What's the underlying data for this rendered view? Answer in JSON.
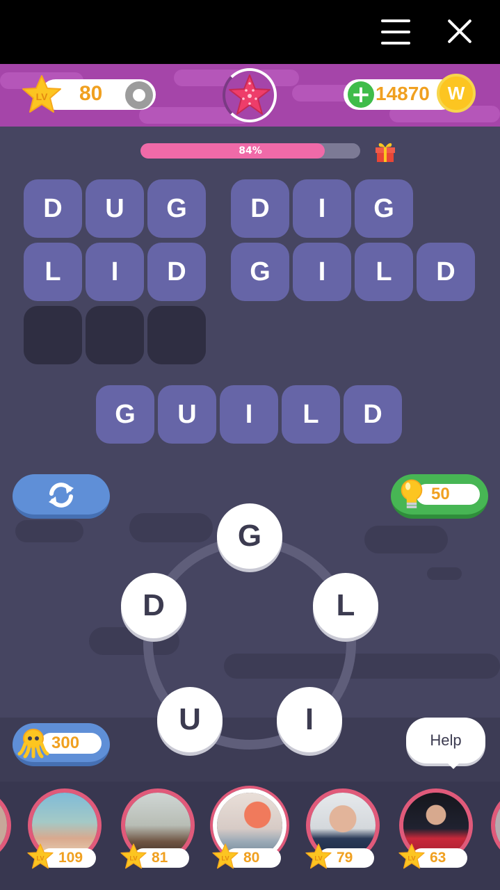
{
  "header": {
    "level": "80",
    "coins": "14870",
    "coin_symbol": "W",
    "star_badge_label": "LV"
  },
  "progress": {
    "label": "84%",
    "value": 0.84
  },
  "puzzle": {
    "words": [
      {
        "letters": [
          "D",
          "U",
          "G"
        ],
        "solved": true
      },
      {
        "letters": [
          "D",
          "I",
          "G"
        ],
        "solved": true
      },
      {
        "letters": [
          "L",
          "I",
          "D"
        ],
        "solved": true
      },
      {
        "letters": [
          "G",
          "I",
          "L",
          "D"
        ],
        "solved": true
      },
      {
        "letters": [
          "",
          "",
          ""
        ],
        "solved": false
      }
    ],
    "current_word": [
      "G",
      "U",
      "I",
      "L",
      "D"
    ]
  },
  "wheel": {
    "letters": [
      "G",
      "L",
      "I",
      "U",
      "D"
    ]
  },
  "hint": {
    "cost": "50"
  },
  "bonus": {
    "count": "300"
  },
  "help": {
    "label": "Help"
  },
  "friends": [
    {
      "level": "109"
    },
    {
      "level": "81"
    },
    {
      "level": "80",
      "is_me": true
    },
    {
      "level": "79"
    },
    {
      "level": "63"
    }
  ],
  "colors": {
    "header": "#a545a9",
    "background": "#464561",
    "tile": "#6665a7",
    "progress_fill": "#f06aa8",
    "hint_button": "#47b654",
    "shuffle_button": "#5f8fd7",
    "coin_text": "#f0a020"
  },
  "icons": [
    "menu-icon",
    "close-icon",
    "lv-star-icon",
    "gear-icon",
    "starfish-icon",
    "plus-icon",
    "coin-icon",
    "gift-icon",
    "shuffle-icon",
    "lightbulb-icon",
    "octopus-icon"
  ]
}
